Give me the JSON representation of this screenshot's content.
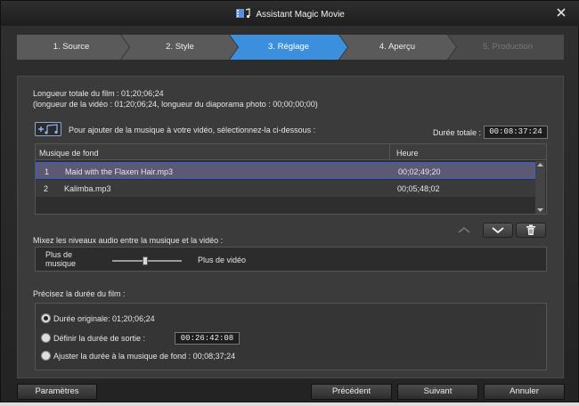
{
  "window": {
    "title": "Assistant Magic Movie",
    "icon": "film-music-icon",
    "close_icon": "close-icon"
  },
  "steps": [
    {
      "label": "1. Source",
      "state": "done"
    },
    {
      "label": "2. Style",
      "state": "done"
    },
    {
      "label": "3. Réglage",
      "state": "active"
    },
    {
      "label": "4. Aperçu",
      "state": "pending"
    },
    {
      "label": "5. Production",
      "state": "disabled"
    }
  ],
  "info": {
    "total_length": "Longueur totale du film : 01;20;06;24",
    "detail": "(longueur de la vidéo : 01;20;06;24, longueur du diaporama photo : 00;00;00;00)"
  },
  "music": {
    "add_music_icon": "add-music-icon",
    "instruction": "Pour ajouter de la musique à votre vidéo, sélectionnez-la ci-dessous :",
    "total_label": "Durée totale :",
    "total_value": "00:08:37:24",
    "columns": [
      "Musique de fond",
      "Heure"
    ],
    "rows": [
      {
        "index": "1",
        "name": "Maid with the Flaxen Hair.mp3",
        "time": "00;02;49;20",
        "selected": true
      },
      {
        "index": "2",
        "name": "Kalimba.mp3",
        "time": "00;05;48;02",
        "selected": false
      }
    ],
    "move_up_icon": "chevron-up-icon",
    "move_down_icon": "chevron-down-icon",
    "delete_icon": "trash-icon"
  },
  "mix": {
    "title": "Mixez les niveaux audio entre la musique et la vidéo :",
    "left_label": "Plus de musique",
    "right_label": "Plus de vidéo",
    "level": 0.5
  },
  "duration": {
    "title": "Précisez la durée du film :",
    "options": [
      {
        "label": "Durée originale: 01;20;06;24",
        "checked": true
      },
      {
        "label": "Définir la durée de sortie :",
        "checked": false
      },
      {
        "label": "Ajuster la durée à la musique de fond : 00;08;37;24",
        "checked": false
      }
    ],
    "output_value": "00:26:42:08"
  },
  "buttons": {
    "settings": "Paramètres",
    "previous": "Précédent",
    "next": "Suivant",
    "cancel": "Annuler"
  },
  "colors": {
    "active_step": "#3b8fdc",
    "selected_row": "#5a5a74",
    "selected_border": "#3d5bd6"
  }
}
